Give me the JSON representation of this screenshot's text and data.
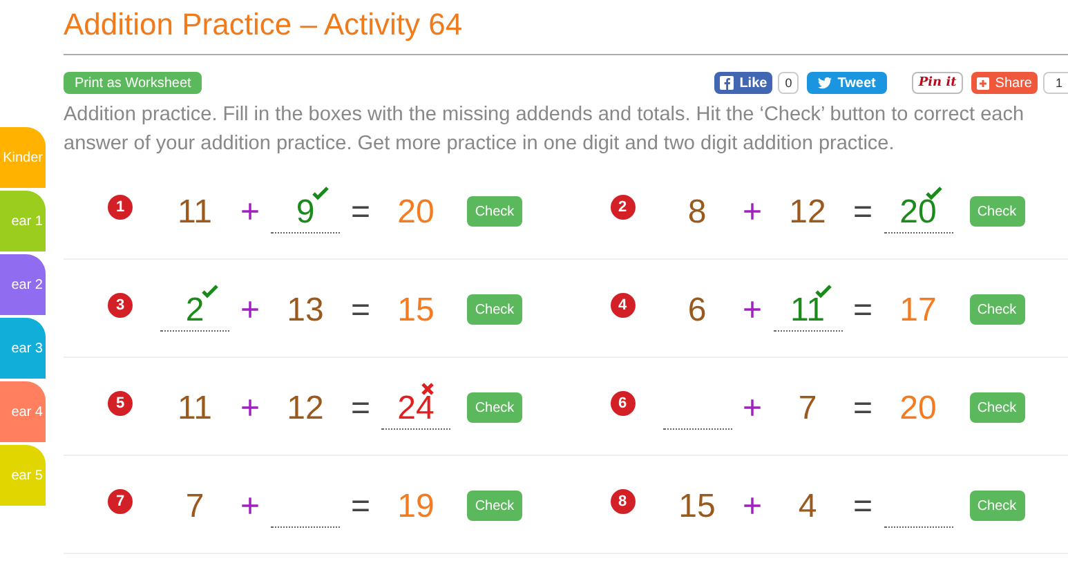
{
  "title": "Addition Practice – Activity 64",
  "print_button": "Print as Worksheet",
  "social": [
    {
      "kind": "like",
      "label": "Like",
      "count": "0"
    },
    {
      "kind": "tweet",
      "label": "Tweet"
    },
    {
      "kind": "pin",
      "label": "Pin it"
    },
    {
      "kind": "share",
      "label": "Share",
      "count": "1"
    }
  ],
  "intro": "Addition practice. Fill in the boxes with the missing addends and totals. Hit the ‘Check’ button to correct each answer of your addition practice. Get more practice in one digit and two digit addition practice.",
  "sidebar": {
    "items": [
      {
        "label": "Kinder",
        "color": "#ffb300"
      },
      {
        "label": "ear 1",
        "color": "#9acd1e"
      },
      {
        "label": "ear 2",
        "color": "#8f6cf0"
      },
      {
        "label": "ear 3",
        "color": "#10aed8"
      },
      {
        "label": "ear 4",
        "color": "#ff7f5f"
      },
      {
        "label": "ear 5",
        "color": "#e2d600"
      }
    ]
  },
  "problems": [
    {
      "number": "1",
      "plus": "+",
      "equals": "=",
      "check": "Check",
      "terms": [
        {
          "kind": "addend",
          "text": "11"
        },
        {
          "kind": "field",
          "value": "9",
          "correct": true,
          "wrong": false
        },
        {
          "kind": "total",
          "text": "20"
        }
      ]
    },
    {
      "number": "2",
      "plus": "+",
      "equals": "=",
      "check": "Check",
      "terms": [
        {
          "kind": "addend",
          "text": "8"
        },
        {
          "kind": "addend",
          "text": "12"
        },
        {
          "kind": "field",
          "value": "20",
          "correct": true,
          "wrong": false
        }
      ]
    },
    {
      "number": "3",
      "plus": "+",
      "equals": "=",
      "check": "Check",
      "terms": [
        {
          "kind": "field",
          "value": "2",
          "correct": true,
          "wrong": false
        },
        {
          "kind": "addend",
          "text": "13"
        },
        {
          "kind": "total",
          "text": "15"
        }
      ]
    },
    {
      "number": "4",
      "plus": "+",
      "equals": "=",
      "check": "Check",
      "terms": [
        {
          "kind": "addend",
          "text": "6"
        },
        {
          "kind": "field",
          "value": "11",
          "correct": true,
          "wrong": false
        },
        {
          "kind": "total",
          "text": "17"
        }
      ]
    },
    {
      "number": "5",
      "plus": "+",
      "equals": "=",
      "check": "Check",
      "terms": [
        {
          "kind": "addend",
          "text": "11"
        },
        {
          "kind": "addend",
          "text": "12"
        },
        {
          "kind": "field",
          "value": "24",
          "correct": false,
          "wrong": true
        }
      ]
    },
    {
      "number": "6",
      "plus": "+",
      "equals": "=",
      "check": "Check",
      "terms": [
        {
          "kind": "field",
          "correct": false,
          "wrong": false
        },
        {
          "kind": "addend",
          "text": "7"
        },
        {
          "kind": "total",
          "text": "20"
        }
      ]
    },
    {
      "number": "7",
      "plus": "+",
      "equals": "=",
      "check": "Check",
      "terms": [
        {
          "kind": "addend",
          "text": "7"
        },
        {
          "kind": "field",
          "correct": false,
          "wrong": false
        },
        {
          "kind": "total",
          "text": "19"
        }
      ]
    },
    {
      "number": "8",
      "plus": "+",
      "equals": "=",
      "check": "Check",
      "terms": [
        {
          "kind": "addend",
          "text": "15"
        },
        {
          "kind": "addend",
          "text": "4"
        },
        {
          "kind": "field",
          "correct": false,
          "wrong": false
        }
      ]
    }
  ]
}
